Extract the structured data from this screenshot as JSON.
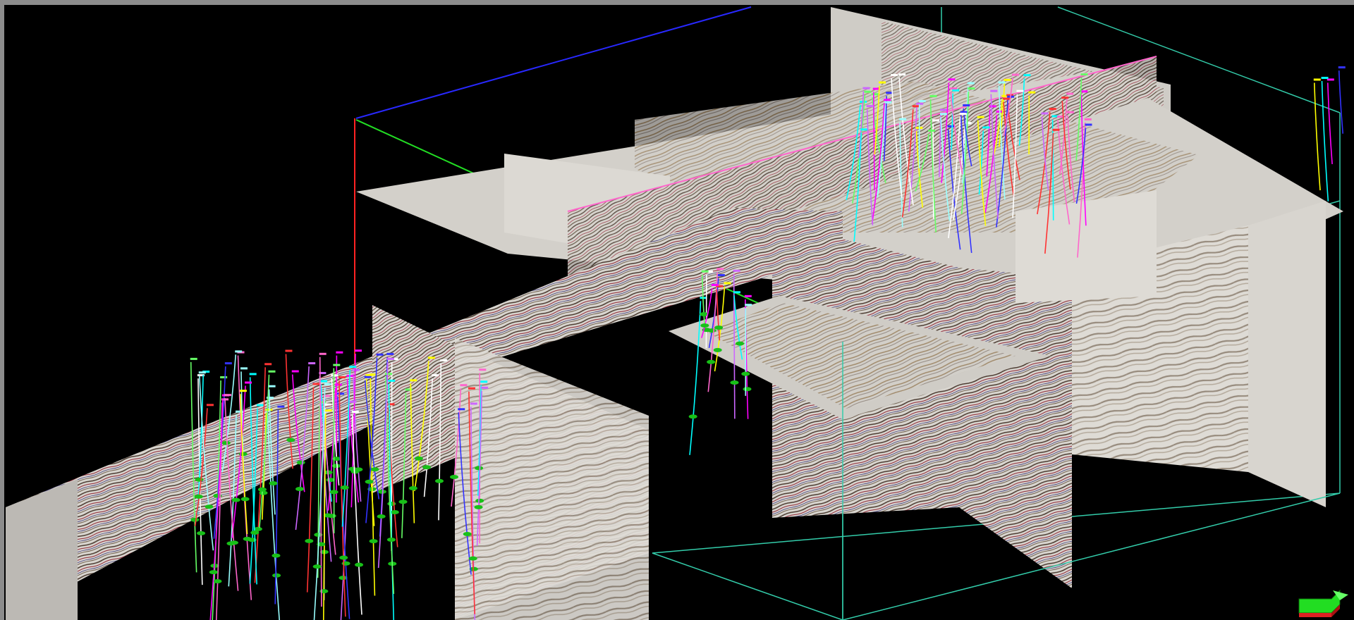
{
  "viewer": {
    "background": "#000000",
    "frame_color": "#8c8c8c"
  },
  "colors": {
    "axis_x": "#ff2222",
    "axis_y": "#2828ff",
    "axis_z": "#22dd22",
    "bbox": "#33ccaa",
    "panel_base": "#d6d3cd",
    "panel_shadow": "#b9b6b1",
    "seis_dark": "#4a3a30",
    "seis_red": "#8c2030",
    "seis_blue": "#302a70",
    "well_markers": "#18c018",
    "triad_front": "#22dd22",
    "triad_bottom": "#dd2222"
  },
  "well_colors": [
    "#ff00ff",
    "#00ffff",
    "#ffff00",
    "#3333ff",
    "#ffffff",
    "#ff66cc",
    "#66ff66",
    "#ff3333",
    "#99ffff",
    "#cc66ff"
  ],
  "icons": {
    "triad": "axis-triad-icon"
  }
}
